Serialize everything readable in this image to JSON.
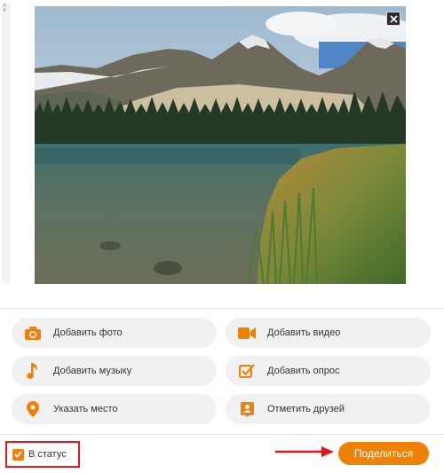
{
  "photo": {
    "close_icon": "close-icon"
  },
  "actions": [
    {
      "label": "Добавить фото",
      "icon": "camera-icon"
    },
    {
      "label": "Добавить видео",
      "icon": "video-camera-icon"
    },
    {
      "label": "Добавить музыку",
      "icon": "music-note-icon"
    },
    {
      "label": "Добавить опрос",
      "icon": "poll-checkbox-icon"
    },
    {
      "label": "Указать место",
      "icon": "location-pin-icon"
    },
    {
      "label": "Отметить друзей",
      "icon": "tag-friends-icon"
    }
  ],
  "footer": {
    "status_label": "В статус",
    "status_checked": true,
    "share_label": "Поделиться"
  },
  "colors": {
    "accent": "#ee8208",
    "highlight": "#e4161b",
    "button_bg": "#f1f1f1"
  }
}
